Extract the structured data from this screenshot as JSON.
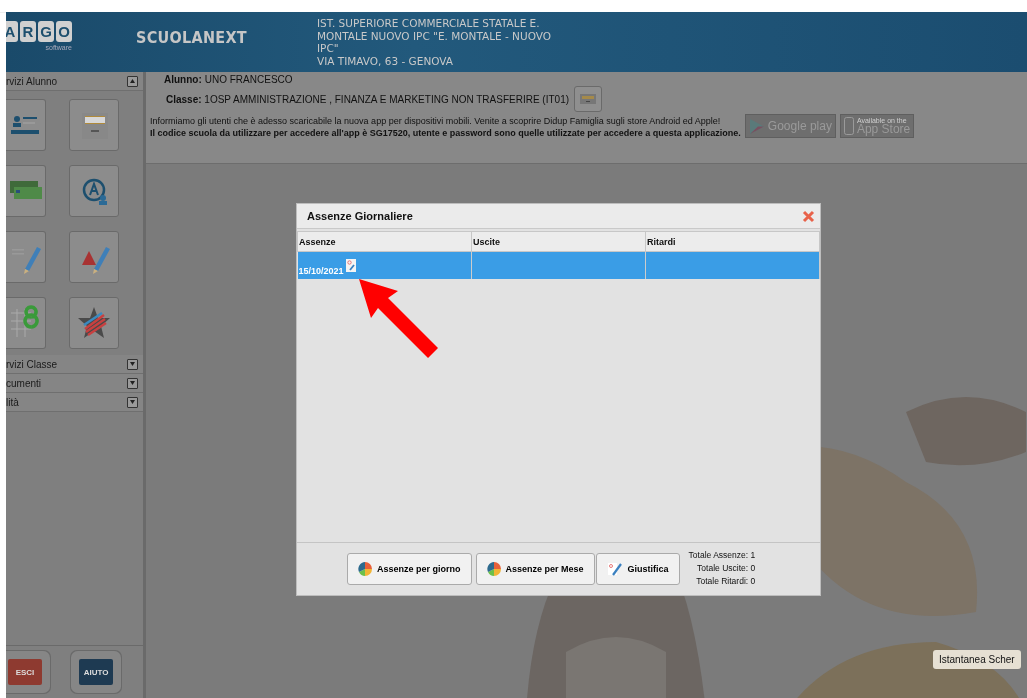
{
  "header": {
    "logo_letters": [
      "A",
      "R",
      "G",
      "O"
    ],
    "logo_subtitle": "software",
    "app_name": "SCUOLANEXT",
    "school_name": "IST. SUPERIORE COMMERCIALE STATALE E. MONTALE NUOVO IPC \"E. MONTALE - NUOVO IPC\"",
    "address": "VIA TIMAVO, 63 - GENOVA"
  },
  "sidebar": {
    "sections": [
      {
        "title": "rvizi Alunno",
        "expanded": true
      },
      {
        "title": "rvizi Classe",
        "expanded": false
      },
      {
        "title": "cumenti",
        "expanded": false
      },
      {
        "title": "lità",
        "expanded": false
      }
    ],
    "tiles": [
      {
        "kind": "profile"
      },
      {
        "kind": "drawer"
      },
      {
        "kind": "money"
      },
      {
        "kind": "grade-user"
      },
      {
        "kind": "grade-pen"
      },
      {
        "kind": "warning-pen"
      },
      {
        "kind": "grid"
      },
      {
        "kind": "star"
      }
    ],
    "footer_buttons": [
      {
        "label": "ESCI",
        "kind": "exit"
      },
      {
        "label": "AIUTO",
        "kind": "help"
      }
    ]
  },
  "info": {
    "student_label": "Alunno:",
    "student": "UNO FRANCESCO",
    "class_label": "Classe:",
    "class": "1OSP AMMINISTRAZIONE , FINANZA E MARKETING NON TRASFERIRE (IT01)",
    "notice": "Informiamo gli utenti che è adesso scaricabile la nuova app per dispositivi mobili. Venite a scoprire Didup Famiglia sugli store Android ed Apple!",
    "code_notice": "Il codice scuola da utilizzare per accedere all'app è SG17520, utente e password sono quelle utilizzate per accedere a questa applicazione.",
    "stores": [
      {
        "kind": "google",
        "big": "Google play"
      },
      {
        "kind": "apple",
        "small": "Available on the",
        "big": "App Store"
      }
    ]
  },
  "dialog": {
    "title": "Assenze Giornaliere",
    "columns": [
      "Assenze",
      "Uscite",
      "Ritardi"
    ],
    "rows": [
      {
        "date": "15/10/2021",
        "selected": true
      }
    ],
    "buttons": [
      {
        "label": "Assenze per giorno",
        "kind": "pie"
      },
      {
        "label": "Assenze per Mese",
        "kind": "pie"
      },
      {
        "label": "Giustifica",
        "kind": "justify"
      }
    ],
    "totals": [
      "Totale Assenze: 1",
      "Totale Uscite: 0",
      "Totale Ritardi: 0"
    ]
  },
  "tooltip": "Istantanea Scher"
}
